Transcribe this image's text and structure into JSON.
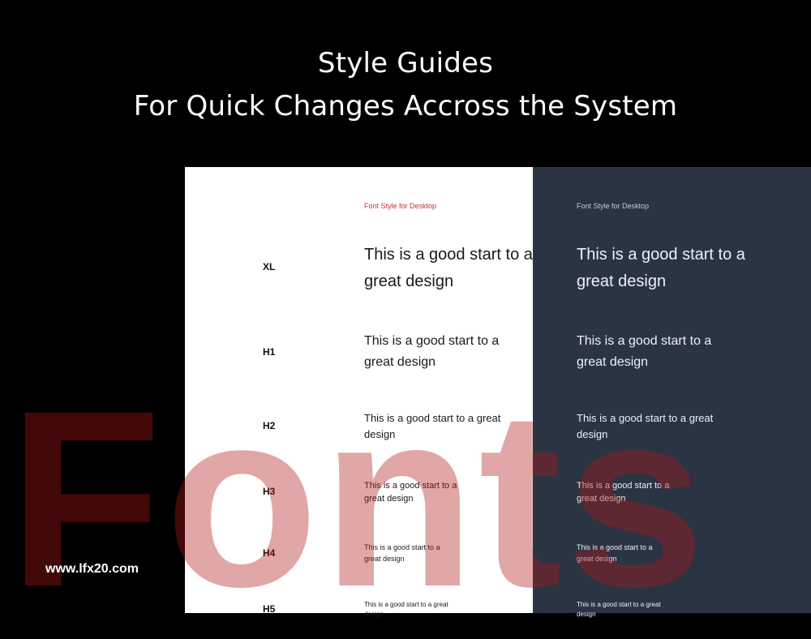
{
  "title": {
    "line1": "Style Guides",
    "line2": "For Quick Changes Accross the System"
  },
  "panel_light": {
    "caption": "Font Style for Desktop"
  },
  "panel_dark": {
    "caption": "Font Style for Desktop"
  },
  "rows": [
    {
      "label": "XL",
      "text": "This is a good start to a great design"
    },
    {
      "label": "H1",
      "text": "This is a good start to a great design"
    },
    {
      "label": "H2",
      "text": "This is a good start to a great design"
    },
    {
      "label": "H3",
      "text": "This is a good start to a great design"
    },
    {
      "label": "H4",
      "text": "This is a good start to a great design"
    },
    {
      "label": "H5",
      "text": "This is a good start to a great design"
    }
  ],
  "watermark": "Fonts",
  "site_url": "www.lfx20.com",
  "colors": {
    "background": "#000000",
    "light_panel": "#ffffff",
    "dark_panel": "#2a3443",
    "caption_light": "#c43434",
    "watermark": "#af1414"
  }
}
